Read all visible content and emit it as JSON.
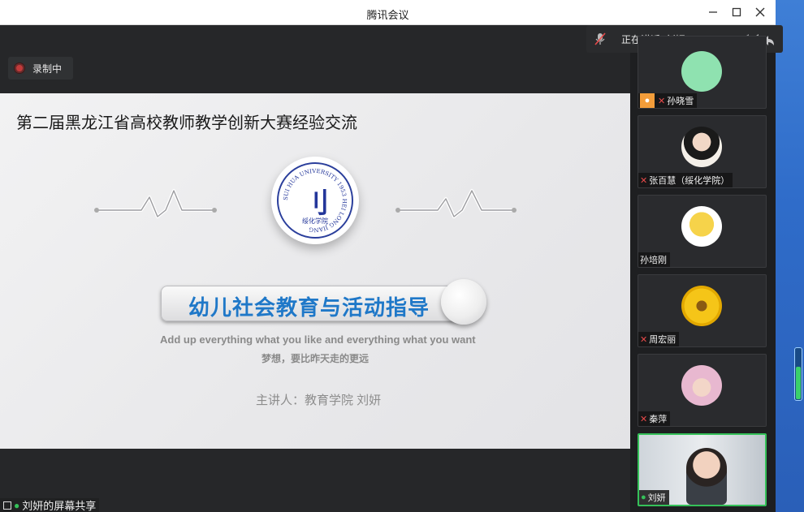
{
  "window": {
    "title": "腾讯会议"
  },
  "recording": {
    "label": "录制中"
  },
  "speaking": {
    "label": "正在讲话: 刘妍;"
  },
  "slide": {
    "title": "第二届黑龙江省高校教师教学创新大赛经验交流",
    "logo_text": "SUI HUA UNIVERSITY 1953 HEI LONG JIANG",
    "logo_sub": "绥化学院",
    "banner": "幼儿社会教育与活动指导",
    "subtitle_en": "Add up everything what you like and everything what you want",
    "subtitle_cn": "梦想，要比昨天走的更远",
    "speaker": "主讲人：教育学院  刘妍"
  },
  "share": {
    "label": "刘妍的屏幕共享"
  },
  "participants": [
    {
      "name": "孙晓雪",
      "mic": "off",
      "avatar_color": "#8fe2b0"
    },
    {
      "name": "张百慧（绥化学院）",
      "mic": "off",
      "avatar_color": "#f4efe8"
    },
    {
      "name": "孙培刚",
      "mic": "none",
      "avatar_color": "#f6d34a"
    },
    {
      "name": "周宏丽",
      "mic": "off",
      "avatar_color": "#f5c518"
    },
    {
      "name": "秦萍",
      "mic": "off",
      "avatar_color": "#e8b8d0"
    },
    {
      "name": "刘妍",
      "mic": "on",
      "avatar_color": "#d8dde3"
    }
  ]
}
